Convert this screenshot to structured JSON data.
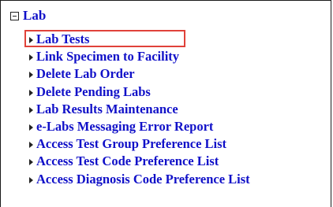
{
  "section": {
    "title": "Lab",
    "expanded": true
  },
  "menu": {
    "items": [
      {
        "label": "Lab Tests",
        "highlighted": true
      },
      {
        "label": "Link Specimen to Facility"
      },
      {
        "label": "Delete Lab Order"
      },
      {
        "label": "Delete Pending Labs"
      },
      {
        "label": "Lab Results Maintenance"
      },
      {
        "label": "e-Labs Messaging Error Report"
      },
      {
        "label": "Access Test Group Preference List"
      },
      {
        "label": "Access Test Code Preference List"
      },
      {
        "label": "Access Diagnosis Code Preference List"
      }
    ]
  },
  "colors": {
    "link": "#1010c8",
    "highlight_border": "#e0423a",
    "frame_border": "#1a1a1a"
  }
}
